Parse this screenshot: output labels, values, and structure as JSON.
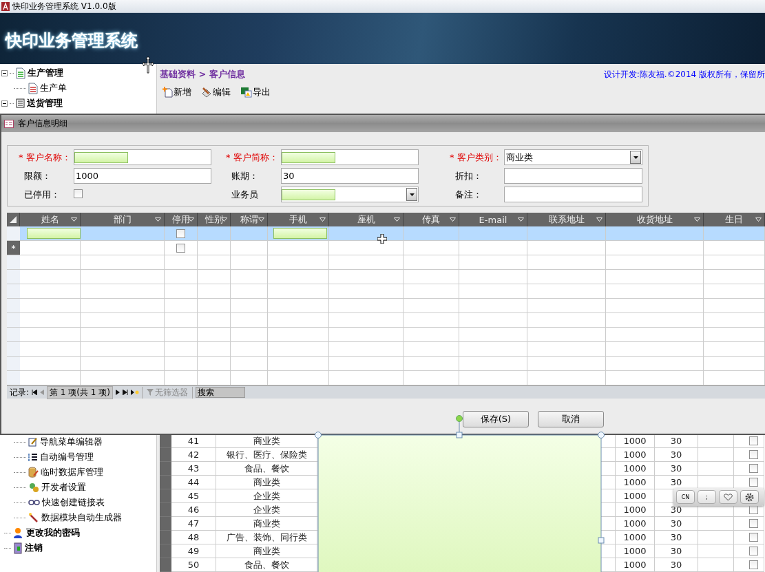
{
  "window": {
    "title": "快印业务管理系统 V1.0.0版"
  },
  "banner": {
    "title": "快印业务管理系统"
  },
  "sidebar": {
    "upper": [
      {
        "label": "生产管理",
        "expanded": true,
        "children": [
          {
            "label": "生产单"
          }
        ]
      },
      {
        "label": "送货管理",
        "expanded": true
      }
    ],
    "lower_children": [
      {
        "label": "导航菜单编辑器"
      },
      {
        "label": "自动编号管理"
      },
      {
        "label": "临时数据库管理"
      },
      {
        "label": "开发者设置"
      },
      {
        "label": "快速创建链接表"
      },
      {
        "label": "数据模块自动生成器"
      }
    ],
    "lower": [
      {
        "label": "更改我的密码"
      },
      {
        "label": "注销"
      }
    ]
  },
  "breadcrumb": "基础资料 > 客户信息",
  "copyright": "设计开发:陈友福.©2014 版权所有，保留所",
  "toolbar": [
    "新增",
    "编辑",
    "导出"
  ],
  "table": {
    "rows": [
      {
        "no": "41",
        "category": "商业类",
        "limit": "1000",
        "term": "30",
        "checked": false
      },
      {
        "no": "42",
        "category": "银行、医疗、保险类",
        "limit": "1000",
        "term": "30",
        "checked": false
      },
      {
        "no": "43",
        "category": "食品、餐饮",
        "limit": "1000",
        "term": "30",
        "checked": false
      },
      {
        "no": "44",
        "category": "商业类",
        "limit": "1000",
        "term": "30",
        "checked": false
      },
      {
        "no": "45",
        "category": "企业类",
        "limit": "1000"
      },
      {
        "no": "46",
        "category": "企业类",
        "limit": "1000",
        "term": "30",
        "checked": false
      },
      {
        "no": "47",
        "category": "商业类",
        "limit": "1000",
        "term": "30",
        "checked": false
      },
      {
        "no": "48",
        "category": "广告、装饰、同行类",
        "limit": "1000",
        "term": "30",
        "checked": false
      },
      {
        "no": "49",
        "category": "商业类",
        "limit": "1000",
        "term": "30",
        "checked": false
      },
      {
        "no": "50",
        "category": "食品、餐饮",
        "limit": "1000",
        "term": "30",
        "checked": false
      }
    ]
  },
  "dialog": {
    "title": "客户信息明细",
    "fields": [
      {
        "label": "客户名称：",
        "required": true,
        "kind": "text",
        "redacted": true
      },
      {
        "label": "客户简称：",
        "required": true,
        "kind": "text",
        "redacted": true
      },
      {
        "label": "客户类别：",
        "required": true,
        "kind": "select",
        "value": "商业类"
      },
      {
        "label": "限额：",
        "required": false,
        "kind": "text",
        "value": "1000"
      },
      {
        "label": "账期：",
        "required": false,
        "kind": "text",
        "value": "30"
      },
      {
        "label": "折扣：",
        "required": false,
        "kind": "text"
      },
      {
        "label": "已停用：",
        "required": false,
        "kind": "checkbox",
        "checked": false
      },
      {
        "label": "业务员",
        "required": false,
        "kind": "select",
        "redacted": true
      },
      {
        "label": "备注：",
        "required": false,
        "kind": "text"
      }
    ],
    "grid": {
      "columns": [
        "姓名",
        "部门",
        "停用",
        "性别",
        "称谓",
        "手机",
        "座机",
        "传真",
        "E-mail",
        "联系地址",
        "收货地址",
        "生日"
      ],
      "rows": [
        {
          "selected": true,
          "name_redacted": true,
          "phone_redacted": true,
          "inactive": false
        },
        {
          "selected": false,
          "marker": "*",
          "inactive": false
        }
      ]
    },
    "nav": {
      "label": "记录:",
      "position": "第 1 项(共 1 项)",
      "filter": "无筛选器",
      "search_placeholder": "搜索"
    },
    "buttons": [
      "保存(S)",
      "取消"
    ]
  },
  "ime_toolbar": {
    "labels": [
      "CN",
      ";"
    ]
  }
}
